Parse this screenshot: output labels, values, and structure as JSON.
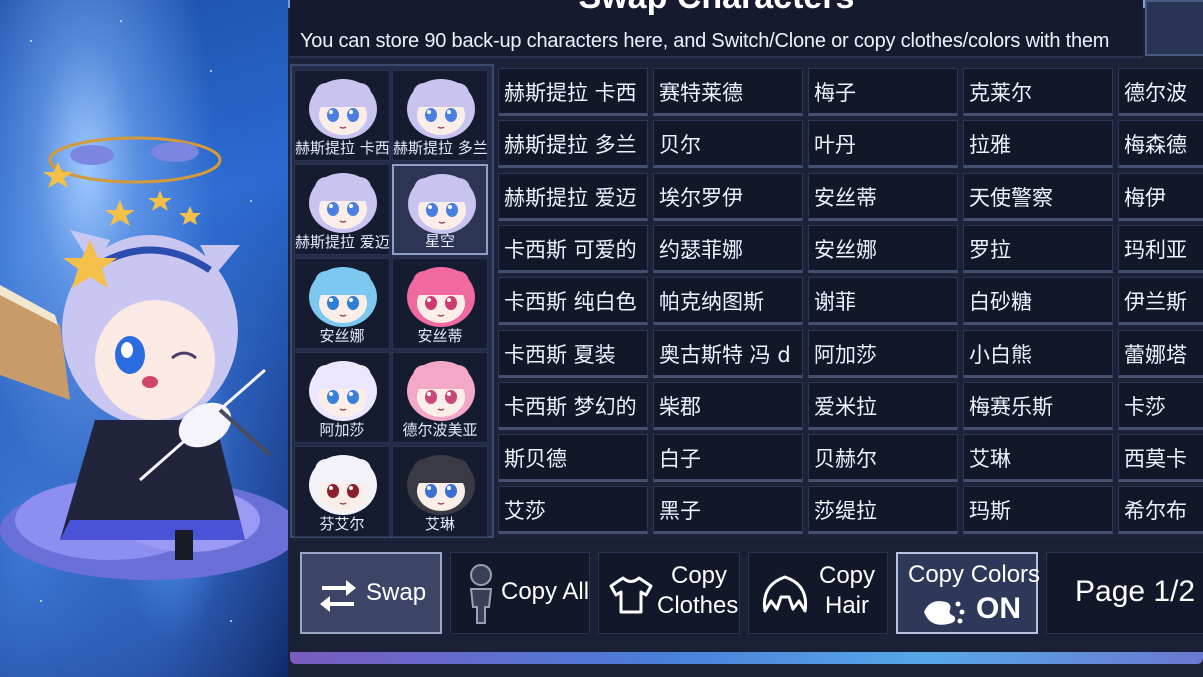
{
  "header": {
    "title": "Swap Characters",
    "subtitle": "You can store 90 back-up characters here, and Switch/Clone or copy clothes/colors with them"
  },
  "slots": [
    {
      "label": "赫斯提拉 卡西",
      "hair": "#c9c3ef",
      "eye": "#4a7ee0"
    },
    {
      "label": "赫斯提拉 多兰",
      "hair": "#c9c3ef",
      "eye": "#4a7ee0"
    },
    {
      "label": "赫斯提拉 爱迈",
      "hair": "#c9c3ef",
      "eye": "#4a7ee0"
    },
    {
      "label": "星空",
      "hair": "#c9c3ef",
      "eye": "#4a7ee0"
    },
    {
      "label": "安丝娜",
      "hair": "#7cc8f0",
      "eye": "#2f7fd8"
    },
    {
      "label": "安丝蒂",
      "hair": "#f06aa0",
      "eye": "#d03870"
    },
    {
      "label": "阿加莎",
      "hair": "#ece6ff",
      "eye": "#3a80d8"
    },
    {
      "label": "德尔波美亚",
      "hair": "#f4a8c8",
      "eye": "#c84878"
    },
    {
      "label": "芬艾尔",
      "hair": "#f2f2f8",
      "eye": "#8a1e2e"
    },
    {
      "label": "艾琳",
      "hair": "#3a3a44",
      "eye": "#3b6fd0"
    }
  ],
  "names": [
    [
      "赫斯提拉 卡西",
      "赛特莱德",
      "梅子",
      "克莱尔",
      "德尔波"
    ],
    [
      "赫斯提拉 多兰",
      "贝尔",
      "叶丹",
      "拉雅",
      "梅森德"
    ],
    [
      "赫斯提拉 爱迈",
      "埃尔罗伊",
      "安丝蒂",
      "天使警察",
      "梅伊"
    ],
    [
      "卡西斯 可爱的",
      "约瑟菲娜",
      "安丝娜",
      "罗拉",
      "玛利亚"
    ],
    [
      "卡西斯 纯白色",
      "帕克纳图斯",
      "谢菲",
      "白砂糖",
      "伊兰斯"
    ],
    [
      "卡西斯 夏装",
      "奥古斯特 冯 d",
      "阿加莎",
      "小白熊",
      "蕾娜塔"
    ],
    [
      "卡西斯 梦幻的",
      "柴郡",
      "爱米拉",
      "梅赛乐斯",
      "卡莎"
    ],
    [
      "斯贝德",
      "白子",
      "贝赫尔",
      "艾琳",
      "西莫卡"
    ],
    [
      "艾莎",
      "黑子",
      "莎缇拉",
      "玛斯",
      "希尔布"
    ]
  ],
  "actions": {
    "swap": "Swap",
    "copy_all": "Copy All",
    "copy_clothes_1": "Copy",
    "copy_clothes_2": "Clothes",
    "copy_hair_1": "Copy",
    "copy_hair_2": "Hair",
    "copy_colors_1": "Copy Colors",
    "copy_colors_2": "ON",
    "page": "Page 1/2"
  },
  "colors": {
    "panel": "#1c2238",
    "cell": "#121729",
    "accent_glow": "#56a8e8"
  }
}
